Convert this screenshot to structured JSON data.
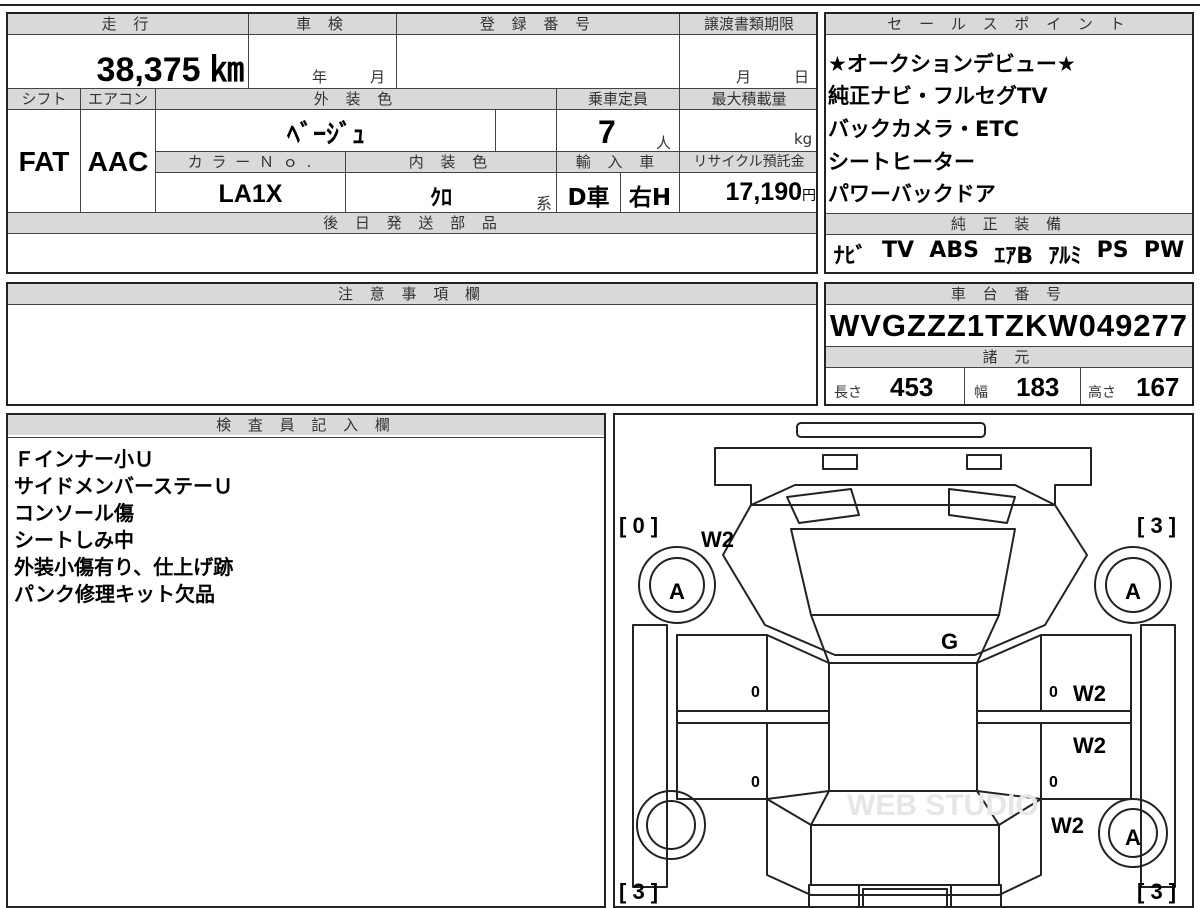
{
  "vehicle": {
    "mileage": {
      "label": "走 行",
      "value": "38,375",
      "unit": "㎞"
    },
    "inspection": {
      "label": "車 検",
      "year_unit": "年",
      "month_unit": "月"
    },
    "registration": {
      "label": "登 録 番 号"
    },
    "transfer_deadline": {
      "label": "譲渡書類期限",
      "month_unit": "月",
      "day_unit": "日"
    },
    "shift": {
      "label": "シフト",
      "value": "FAT"
    },
    "aircon": {
      "label": "エアコン",
      "value": "AAC"
    },
    "exterior_color": {
      "label": "外 装 色",
      "value": "ﾍﾞｰｼﾞｭ"
    },
    "capacity": {
      "label": "乗車定員",
      "value": "7",
      "unit": "人"
    },
    "max_load": {
      "label": "最大積載量",
      "unit": "kg"
    },
    "color_no": {
      "label": "カ ラ ー Ｎ ｏ .",
      "value": "LA1X"
    },
    "interior_color": {
      "label": "内 装 色",
      "value": "ｸﾛ",
      "suffix": "系"
    },
    "import": {
      "label": "輸 入 車",
      "dealer": "D車",
      "handle": "右H"
    },
    "recycle_fee": {
      "label": "リサイクル預託金",
      "value": "17,190",
      "unit": "円"
    },
    "later_parts": {
      "label": "後 日 発 送 部 品"
    }
  },
  "sales_points": {
    "label": "セ ー ル ス ポ イ ン ト",
    "items": [
      "★オークションデビュー★",
      "純正ナビ・フルセグTV",
      "バックカメラ・ETC",
      "シートヒーター",
      "パワーバックドア"
    ]
  },
  "equipment": {
    "label": "純 正 装 備",
    "items": [
      "ﾅﾋﾞ",
      "TV",
      "ABS",
      "ｴｱB",
      "ｱﾙﾐ",
      "PS",
      "PW"
    ]
  },
  "caution": {
    "label": "注 意 事 項 欄"
  },
  "chassis": {
    "label": "車 台 番 号",
    "value": "WVGZZZ1TZKW049277"
  },
  "specs": {
    "label": "諸 元",
    "length": {
      "label": "長さ",
      "value": "453"
    },
    "width": {
      "label": "幅",
      "value": "183"
    },
    "height": {
      "label": "高さ",
      "value": "167"
    }
  },
  "inspector": {
    "label": "検 査 員 記 入 欄",
    "notes": [
      "Ｆインナー小Ｕ",
      "サイドメンバーステーＵ",
      "コンソール傷",
      "シートしみ中",
      "外装小傷有り、仕上げ跡",
      "パンク修理キット欠品"
    ]
  },
  "diagram": {
    "tire_fl": "[ 0 ]",
    "tire_fr": "[ 3 ]",
    "tire_rl": "[ 3 ]",
    "tire_rr": "[ 3 ]",
    "marks": {
      "a1": "A",
      "a2": "A",
      "a3": "A",
      "w2_front_left": "W2",
      "g_windshield": "G",
      "w2_door_fr": "W2",
      "w2_door_rr": "W2",
      "w2_rear_right": "W2",
      "zero_1": "0",
      "zero_2": "0",
      "zero_3": "0",
      "zero_4": "0"
    },
    "watermark": "WEB STUDIO"
  }
}
